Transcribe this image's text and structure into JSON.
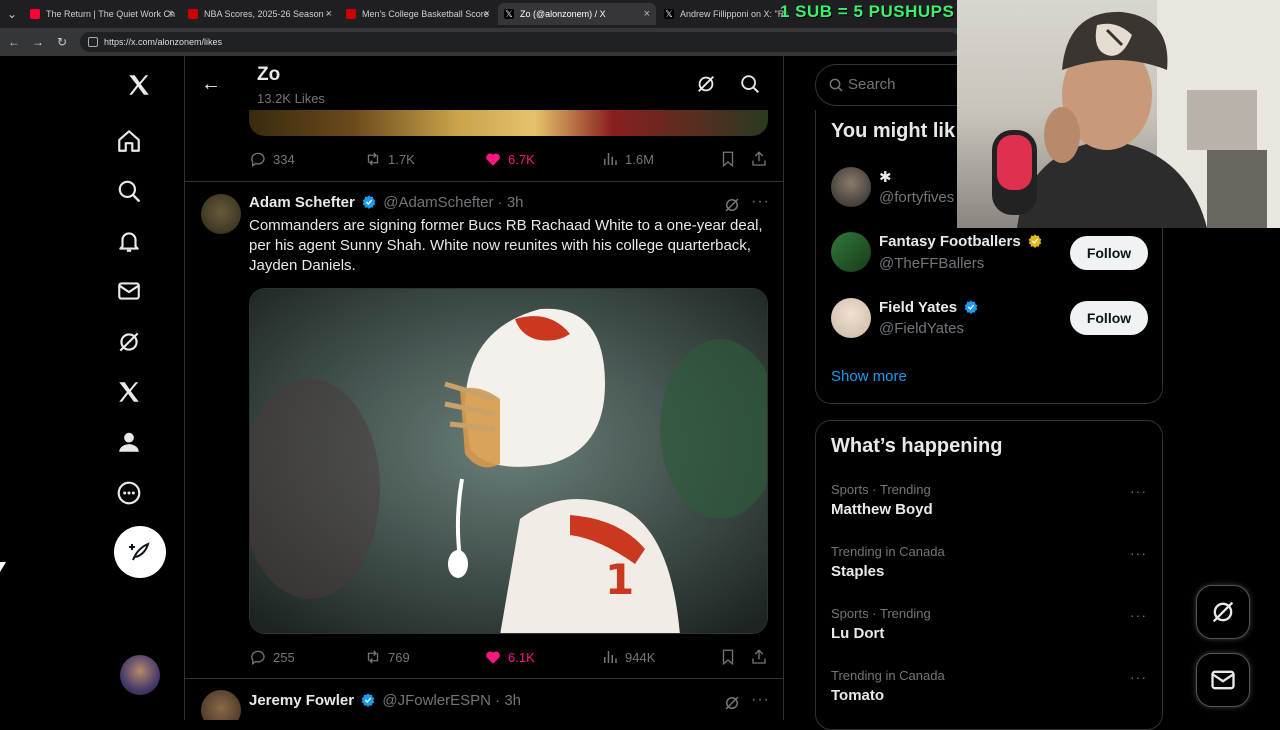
{
  "browser": {
    "tabs": [
      {
        "label": "The Return | The Quiet Work Ch",
        "close": "×"
      },
      {
        "label": "NBA Scores, 2025-26 Season - ",
        "close": "×"
      },
      {
        "label": "Men's College Basketball Score",
        "close": "×"
      },
      {
        "label": "Zo (@alonzonem) / X",
        "close": "×"
      },
      {
        "label": "Andrew Fillipponi on X: \"Rum",
        "close": ""
      }
    ],
    "url": "https://x.com/alonzonem/likes",
    "overlay_text": "1 SUB = 5 PUSHUPS"
  },
  "header": {
    "title": "Zo",
    "subtitle": "13.2K Likes"
  },
  "tweets": [
    {
      "replies": "334",
      "retweets": "1.7K",
      "likes": "6.7K",
      "views": "1.6M"
    },
    {
      "name": "Adam Schefter",
      "handle": "@AdamSchefter",
      "time": "· 3h",
      "text": "Commanders are signing former Bucs RB Rachaad White to a one-year deal, per his agent Sunny Shah. White now reunites with his college quarterback, Jayden Daniels.",
      "replies": "255",
      "retweets": "769",
      "likes": "6.1K",
      "views": "944K"
    },
    {
      "name": "Jeremy Fowler",
      "handle": "@JFowlerESPN",
      "time": "· 3h"
    }
  ],
  "search": {
    "placeholder": "Search"
  },
  "who_to_follow": {
    "title": "You might lik",
    "items": [
      {
        "name": "✱",
        "handle": "@fortyfives"
      },
      {
        "name": "Fantasy Footballers",
        "handle": "@TheFFBallers",
        "button": "Follow"
      },
      {
        "name": "Field Yates",
        "handle": "@FieldYates",
        "button": "Follow"
      }
    ],
    "show_more": "Show more"
  },
  "trending": {
    "title": "What’s happening",
    "items": [
      {
        "meta": "Sports · Trending",
        "name": "Matthew Boyd"
      },
      {
        "meta": "Trending in Canada",
        "name": "Staples"
      },
      {
        "meta": "Sports · Trending",
        "name": "Lu Dort"
      },
      {
        "meta": "Trending in Canada",
        "name": "Tomato"
      }
    ]
  },
  "colors": {
    "like": "#f91880",
    "verified_blue": "#1d9bf0",
    "verified_gold": "#e2b719",
    "overlay_green": "#3df06a"
  }
}
